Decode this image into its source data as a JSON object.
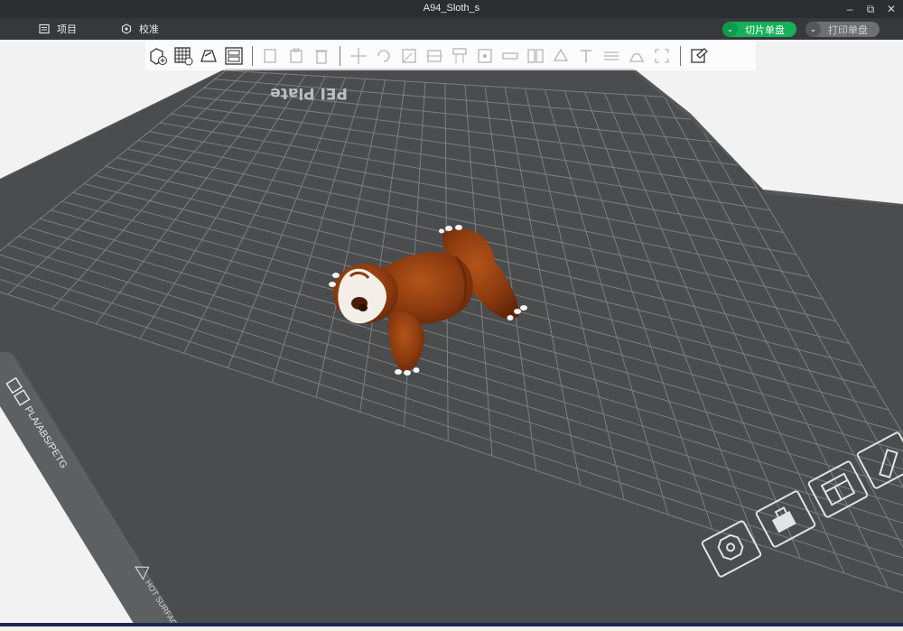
{
  "window": {
    "title": "A94_Sloth_s",
    "minimize_icon": "minimize-icon",
    "restore_icon": "restore-icon",
    "close_icon": "close-icon"
  },
  "menu": {
    "items": [
      {
        "label": "项目",
        "icon": "project-icon"
      },
      {
        "label": "校准",
        "icon": "calibration-icon"
      }
    ]
  },
  "actions": {
    "slice_label": "切片单盘",
    "print_label": "打印单盘"
  },
  "toolbar": {
    "tools": [
      "add-object",
      "arrange-grid",
      "auto-orient",
      "layout",
      "copy",
      "paste",
      "move",
      "rotate",
      "scale",
      "cut",
      "support",
      "seam",
      "measure",
      "split",
      "assembly",
      "text",
      "variable-layer",
      "flatten",
      "fit-bounds",
      "settings"
    ]
  },
  "plate": {
    "brand_text": "PEI Plate",
    "material_text": "PLA/ABS/PETG",
    "warning_text": "HOT SURFACE",
    "bed_color": "#4a4c4e",
    "grid_color": "#7c7f82",
    "model_name": "sloth",
    "model_color": "#8b3a0e"
  }
}
